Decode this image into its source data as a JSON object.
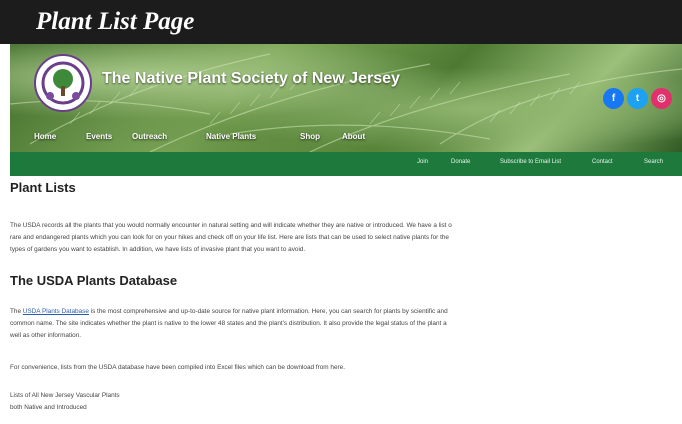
{
  "caption": "Plant List Page",
  "header": {
    "site_title": "The Native Plant Society of New Jersey",
    "social": [
      {
        "icon": "facebook-icon",
        "glyph": "f",
        "color": "#1877f2"
      },
      {
        "icon": "twitter-icon",
        "glyph": "t",
        "color": "#1da1f2"
      },
      {
        "icon": "instagram-icon",
        "glyph": "◎",
        "color": "#e1306c"
      }
    ],
    "main_nav": [
      "Home",
      "Events",
      "Outreach",
      "Native Plants",
      "Shop",
      "About"
    ]
  },
  "sub_nav": [
    "Join",
    "Donate",
    "Subscribe to Email List",
    "Contact",
    "Search"
  ],
  "main": {
    "plant_lists_heading": "Plant Lists",
    "plant_lists_p1": "The USDA records all the plants that you would normally encounter in natural setting and will indicate whether they are native or introduced. We have a list o",
    "plant_lists_p2": "rare and endangered plants which you can look for on your hikes and check off on your life list. Here are lists that can be used to select native plants for the",
    "plant_lists_p3": "types of gardens you want to establish. In addition, we have lists of invasive plant that you want to avoid.",
    "usda_heading": "The USDA Plants Database",
    "usda_link": "USDA Plants Database",
    "usda_p1_pre": "The",
    "usda_p1_post": "is the most comprehensive and up-to-date source for native plant information. Here, you can search for plants by scientific and",
    "usda_p2": "common name. The site indicates whether the plant is native to the lower 48 states and the plant's distribution. It also provide the legal status of the plant a",
    "usda_p3": "well as other information.",
    "excel_p": "For convenience, lists from the USDA database have been compiled into Excel files which can be download from here.",
    "list_title": "Lists of All New Jersey Vascular Plants",
    "list_sub": "both Native and Introduced"
  },
  "colors": {
    "caption_bg": "#1c1c1c",
    "nav_green": "#1e7a3c",
    "link": "#2a5db0"
  }
}
